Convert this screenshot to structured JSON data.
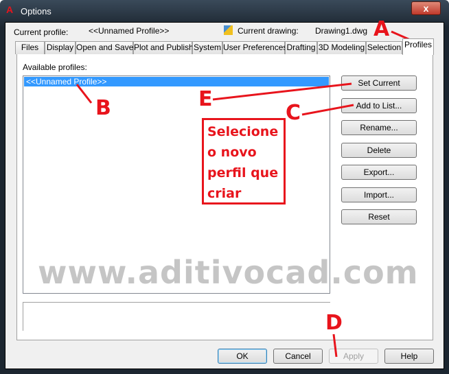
{
  "window": {
    "title": "Options",
    "close_label": "x"
  },
  "header": {
    "current_profile_label": "Current profile:",
    "current_profile": "<<Unnamed Profile>>",
    "current_drawing_label": "Current drawing:",
    "current_drawing": "Drawing1.dwg"
  },
  "tabs": [
    "Files",
    "Display",
    "Open and Save",
    "Plot and Publish",
    "System",
    "User Preferences",
    "Drafting",
    "3D Modeling",
    "Selection",
    "Profiles"
  ],
  "active_tab": "Profiles",
  "profiles": {
    "label": "Available profiles:",
    "items": [
      "<<Unnamed Profile>>"
    ]
  },
  "side_buttons": [
    "Set Current",
    "Add to List...",
    "Rename...",
    "Delete",
    "Export...",
    "Import...",
    "Reset"
  ],
  "footer": {
    "ok": "OK",
    "cancel": "Cancel",
    "apply": "Apply",
    "help": "Help"
  },
  "annotations": {
    "letters": [
      "A",
      "B",
      "C",
      "D",
      "E"
    ],
    "note": "Selecione o novo perfil que criar",
    "watermark": "www.aditivocad.com",
    "color": "#e8141c"
  }
}
